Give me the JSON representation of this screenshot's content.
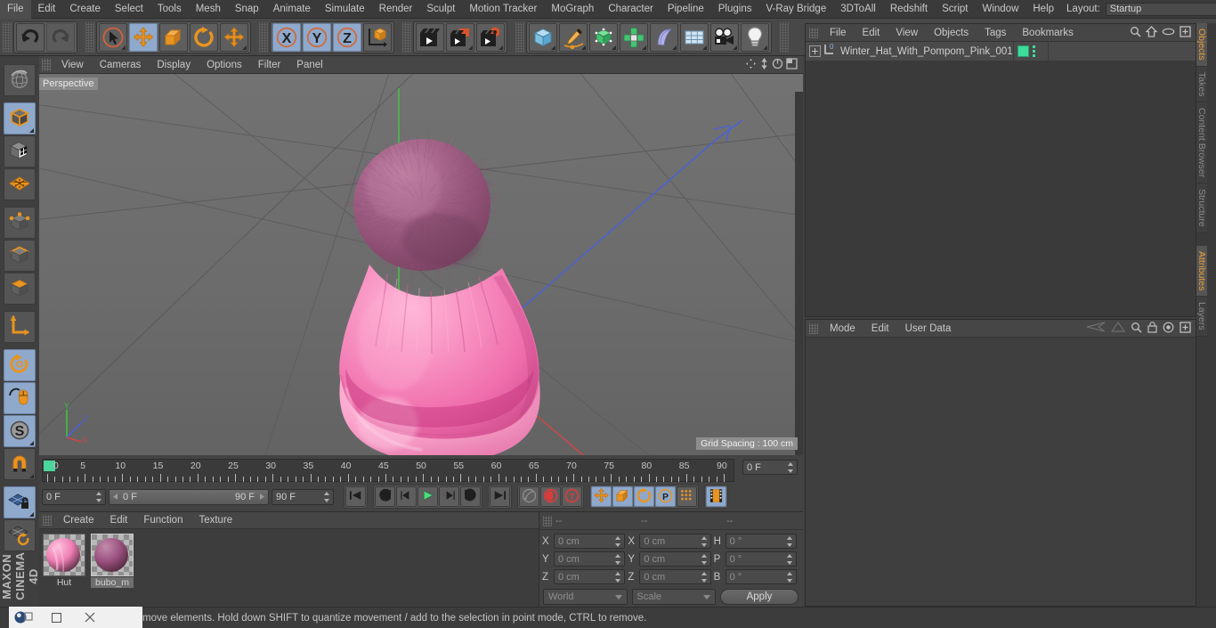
{
  "menubar": {
    "items": [
      "File",
      "Edit",
      "Create",
      "Select",
      "Tools",
      "Mesh",
      "Snap",
      "Animate",
      "Simulate",
      "Render",
      "Sculpt",
      "Motion Tracker",
      "MoGraph",
      "Character",
      "Pipeline",
      "Plugins",
      "V-Ray Bridge",
      "3DToAll",
      "Redshift",
      "Script",
      "Window",
      "Help"
    ],
    "layout_label": "Layout:",
    "layout_value": "Startup",
    "search_icon": "magnifier-icon"
  },
  "toolbar": {
    "groups": [
      {
        "name": "history",
        "buttons": [
          {
            "name": "undo-button",
            "icon": "undo-arrow-icon",
            "selected": false,
            "disabled": false,
            "menu": false
          },
          {
            "name": "redo-button",
            "icon": "redo-arrow-icon",
            "selected": false,
            "disabled": true,
            "menu": false
          }
        ]
      },
      {
        "name": "transform",
        "buttons": [
          {
            "name": "live-selection-button",
            "icon": "cursor-circle-icon",
            "selected": false,
            "disabled": false,
            "menu": true
          },
          {
            "name": "move-button",
            "icon": "move-arrows-icon",
            "selected": true,
            "disabled": false,
            "menu": false
          },
          {
            "name": "scale-button",
            "icon": "scale-box-icon",
            "selected": false,
            "disabled": false,
            "menu": false
          },
          {
            "name": "rotate-button",
            "icon": "rotate-arrow-icon",
            "selected": false,
            "disabled": false,
            "menu": false
          },
          {
            "name": "dynamic-place-button",
            "icon": "move-arrows-icon",
            "selected": false,
            "disabled": false,
            "menu": true
          }
        ]
      },
      {
        "name": "axis-locks",
        "buttons": [
          {
            "name": "lock-x-button",
            "icon": "axis-x-icon",
            "selected": true,
            "disabled": false,
            "menu": false
          },
          {
            "name": "lock-y-button",
            "icon": "axis-y-icon",
            "selected": true,
            "disabled": false,
            "menu": false
          },
          {
            "name": "lock-z-button",
            "icon": "axis-z-icon",
            "selected": true,
            "disabled": false,
            "menu": false
          },
          {
            "name": "world-object-coord-button",
            "icon": "world-axis-cube-icon",
            "selected": false,
            "disabled": false,
            "menu": false
          }
        ]
      },
      {
        "name": "render",
        "buttons": [
          {
            "name": "render-view-button",
            "icon": "clapper-view-icon",
            "selected": false,
            "disabled": false,
            "menu": false
          },
          {
            "name": "render-to-picture-button",
            "icon": "clapper-picture-icon",
            "selected": false,
            "disabled": false,
            "menu": true
          },
          {
            "name": "render-settings-button",
            "icon": "clapper-gear-icon",
            "selected": false,
            "disabled": false,
            "menu": true
          }
        ]
      },
      {
        "name": "objects",
        "buttons": [
          {
            "name": "add-cube-button",
            "icon": "blue-cube-icon",
            "selected": false,
            "disabled": false,
            "menu": true
          },
          {
            "name": "add-spline-button",
            "icon": "pen-spline-icon",
            "selected": false,
            "disabled": false,
            "menu": true
          },
          {
            "name": "add-generator-button",
            "icon": "green-cube-generator-icon",
            "selected": false,
            "disabled": false,
            "menu": true
          },
          {
            "name": "add-array-button",
            "icon": "green-cluster-icon",
            "selected": false,
            "disabled": false,
            "menu": true
          },
          {
            "name": "add-deformer-button",
            "icon": "purple-bend-icon",
            "selected": false,
            "disabled": false,
            "menu": true
          },
          {
            "name": "add-environment-button",
            "icon": "grid-floor-icon",
            "selected": false,
            "disabled": false,
            "menu": true
          },
          {
            "name": "add-camera-button",
            "icon": "camera-icon",
            "selected": false,
            "disabled": false,
            "menu": true
          },
          {
            "name": "add-light-button",
            "icon": "lightbulb-icon",
            "selected": false,
            "disabled": false,
            "menu": true
          }
        ]
      }
    ]
  },
  "left_palette": {
    "buttons": [
      {
        "name": "make-editable-button",
        "icon": "globe-sphere-icon",
        "selected": false,
        "menu": false
      },
      {
        "name": "model-mode-button",
        "icon": "orange-edge-cube-icon",
        "selected": true,
        "menu": true
      },
      {
        "name": "texture-mode-button",
        "icon": "checker-cube-icon",
        "selected": false,
        "menu": false
      },
      {
        "name": "workplane-mode-button",
        "icon": "orange-grid-plane-icon",
        "selected": false,
        "menu": false
      },
      {
        "name": "points-mode-button",
        "icon": "point-cube-icon",
        "selected": false,
        "menu": false
      },
      {
        "name": "edges-mode-button",
        "icon": "edge-cube-icon",
        "selected": false,
        "menu": false
      },
      {
        "name": "polygons-mode-button",
        "icon": "polygon-cube-icon",
        "selected": false,
        "menu": false
      },
      {
        "name": "axis-modify-button",
        "icon": "orange-axis-icon",
        "selected": false,
        "menu": false
      },
      {
        "name": "enable-axis-button",
        "icon": "orange-circle-arrow-icon",
        "selected": true,
        "menu": false
      },
      {
        "name": "viewport-solo-button",
        "icon": "mouse-spline-icon",
        "selected": true,
        "menu": false
      },
      {
        "name": "soft-selection-button",
        "icon": "s-circle-icon",
        "selected": true,
        "menu": true
      },
      {
        "name": "snap-magnet-button",
        "icon": "magnet-icon",
        "selected": false,
        "menu": true
      },
      {
        "name": "workplane-lock-button",
        "icon": "grid-lock-icon",
        "selected": true,
        "menu": true
      },
      {
        "name": "workplane-reset-button",
        "icon": "grid-reset-icon",
        "selected": false,
        "menu": false
      }
    ],
    "brand_line1": "MAXON",
    "brand_line2": "CINEMA 4D"
  },
  "viewport": {
    "menu_items": [
      "View",
      "Cameras",
      "Display",
      "Options",
      "Filter",
      "Panel"
    ],
    "corner_icons": [
      "pan-icon",
      "dolly-icon",
      "orbit-icon",
      "maximize-icon"
    ],
    "camera_label": "Perspective",
    "grid_spacing": "Grid Spacing : 100 cm",
    "axis_labels": {
      "x": "X",
      "y": "Y",
      "z": "Z"
    },
    "axis_colors": {
      "x": "#dd4444",
      "y": "#44cc44",
      "z": "#4466dd"
    },
    "model_colors": {
      "hat_light": "#f48ec0",
      "hat_mid": "#ef6fae",
      "hat_dark": "#d9559a",
      "pompom": "#9e5580",
      "pompom_light": "#b06c92"
    }
  },
  "timeline": {
    "ticks": [
      0,
      5,
      10,
      15,
      20,
      25,
      30,
      35,
      40,
      45,
      50,
      55,
      60,
      65,
      70,
      75,
      80,
      85,
      90
    ],
    "current_frame_field": "0 F",
    "start_field": "0 F",
    "range_start": "0 F",
    "range_end": "90 F",
    "end_field": "90 F",
    "playback_buttons": [
      {
        "name": "go-to-start-button",
        "icon": "skip-start-icon",
        "selected": false
      },
      {
        "name": "play-previous-key-button",
        "icon": "rewind-key-icon",
        "selected": false
      },
      {
        "name": "step-back-button",
        "icon": "step-back-icon",
        "selected": false
      },
      {
        "name": "play-forward-button",
        "icon": "play-icon",
        "selected": false
      },
      {
        "name": "step-forward-button",
        "icon": "step-forward-icon",
        "selected": false
      },
      {
        "name": "play-next-key-button",
        "icon": "forward-key-icon",
        "selected": false
      },
      {
        "name": "go-to-end-button",
        "icon": "skip-end-icon",
        "selected": false
      }
    ],
    "key_buttons": [
      {
        "name": "autokeying-button",
        "icon": "key-icon",
        "selected": false
      },
      {
        "name": "record-active-objects-button",
        "icon": "record-red-icon",
        "selected": false
      },
      {
        "name": "keyframe-selection-button",
        "icon": "question-red-icon",
        "selected": false
      }
    ],
    "record_toggles": [
      {
        "name": "record-position-button",
        "icon": "move-arrows-icon",
        "selected": true
      },
      {
        "name": "record-scale-button",
        "icon": "scale-box-icon",
        "selected": true
      },
      {
        "name": "record-rotation-button",
        "icon": "rotate-arrow-icon",
        "selected": true
      },
      {
        "name": "record-pla-button",
        "icon": "p-circle-icon",
        "selected": true
      },
      {
        "name": "record-parameter-button",
        "icon": "dots-grid-icon",
        "selected": false
      },
      {
        "name": "keyframe-options-button",
        "icon": "filmstrip-icon",
        "selected": true
      }
    ]
  },
  "material_manager": {
    "menu_items": [
      "Create",
      "Edit",
      "Function",
      "Texture"
    ],
    "materials": [
      {
        "name": "Hut",
        "selected": false,
        "color": "#ef7fb5"
      },
      {
        "name": "bubo_m",
        "selected": true,
        "color": "#9b5280"
      }
    ]
  },
  "coordinates": {
    "col_headers": [
      "--",
      "--",
      "--"
    ],
    "rows": [
      {
        "pos_label": "X",
        "pos_value": "0 cm",
        "size_label": "X",
        "size_value": "0 cm",
        "rot_label": "H",
        "rot_value": "0 °"
      },
      {
        "pos_label": "Y",
        "pos_value": "0 cm",
        "size_label": "Y",
        "size_value": "0 cm",
        "rot_label": "P",
        "rot_value": "0 °"
      },
      {
        "pos_label": "Z",
        "pos_value": "0 cm",
        "size_label": "Z",
        "size_value": "0 cm",
        "rot_label": "B",
        "rot_value": "0 °"
      }
    ],
    "system_value": "World",
    "mode_value": "Scale",
    "apply_label": "Apply"
  },
  "object_manager": {
    "menu_items": [
      "File",
      "Edit",
      "View",
      "Objects",
      "Tags",
      "Bookmarks"
    ],
    "header_icons": [
      "magnifier-icon",
      "home-icon",
      "ellipse-icon",
      "plus-box-icon"
    ],
    "objects": [
      {
        "name": "Winter_Hat_With_Pompom_Pink_001",
        "layer_badge": "0",
        "tag_color": "#3ddc9a"
      }
    ]
  },
  "attribute_manager": {
    "menu_items": [
      "Mode",
      "Edit",
      "User Data"
    ],
    "header_icons": [
      "back-nav-icon",
      "forward-nav-icon",
      "magnifier-icon",
      "lock-icon",
      "target-icon",
      "plus-box-icon"
    ]
  },
  "right_tabs": {
    "upper": [
      {
        "label": "Objects",
        "active": true
      },
      {
        "label": "Takes",
        "active": false
      },
      {
        "label": "Content Browser",
        "active": false
      },
      {
        "label": "Structure",
        "active": false
      }
    ],
    "lower": [
      {
        "label": "Attributes",
        "active": true
      },
      {
        "label": "Layers",
        "active": false
      }
    ]
  },
  "status_bar": {
    "message": "move elements. Hold down SHIFT to quantize movement / add to the selection in point mode, CTRL to remove.",
    "taskbar_icons": [
      "c4d-app-icon",
      "restore-window-icon",
      "minimize-icon",
      "close-icon"
    ]
  }
}
